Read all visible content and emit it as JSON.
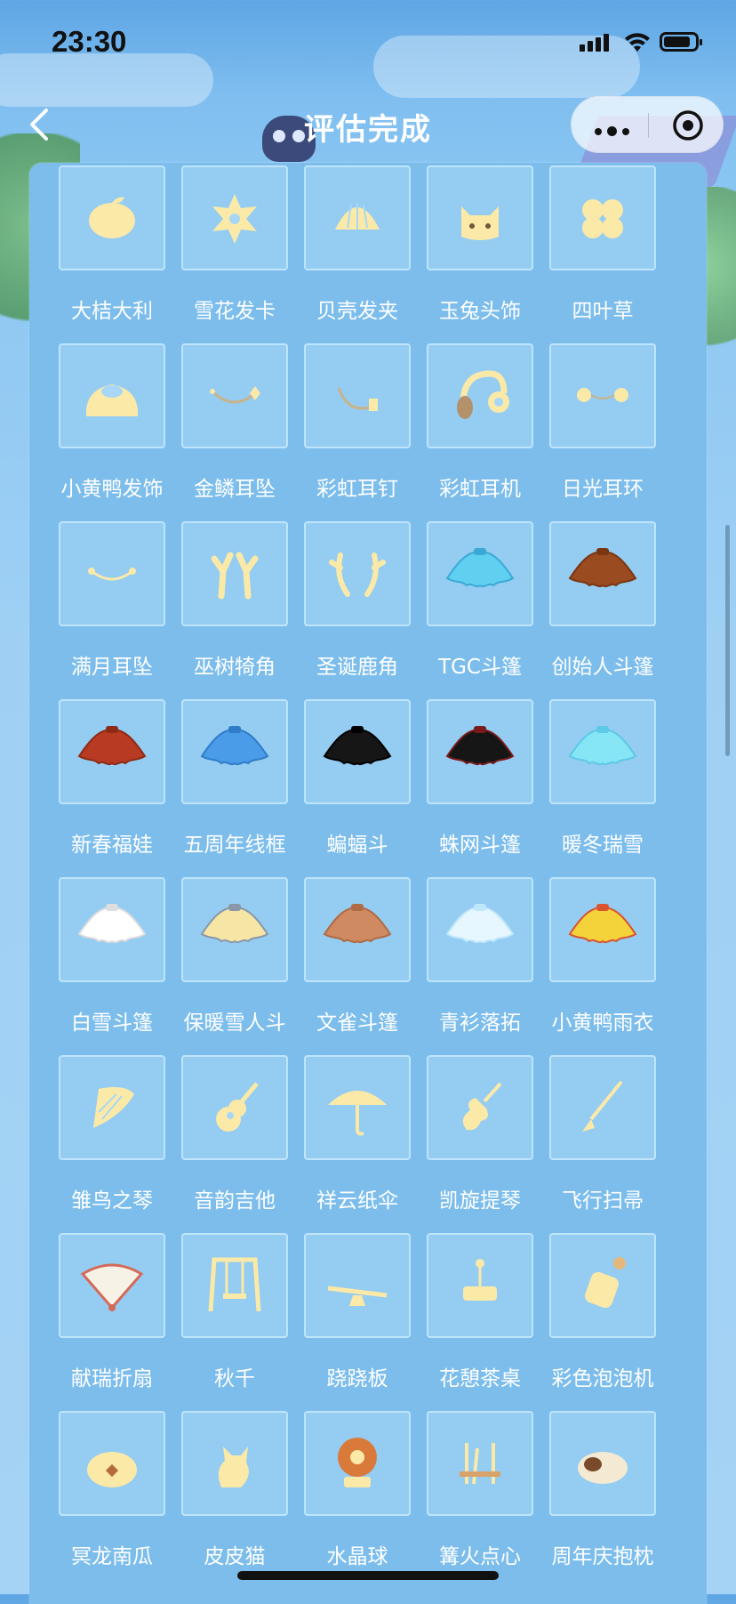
{
  "status_bar": {
    "time": "23:30",
    "battery_level": 0.85
  },
  "nav": {
    "title": "评估完成"
  },
  "colors": {
    "icon_yellow": "#fbe9a8",
    "label": "#ffffff",
    "tile_bg": "#a8d7f5"
  },
  "items": [
    {
      "label": "大桔大利",
      "icon": "tangerine-icon"
    },
    {
      "label": "雪花发卡",
      "icon": "snowflake-hairpin-icon"
    },
    {
      "label": "贝壳发夹",
      "icon": "shell-hairclip-icon"
    },
    {
      "label": "玉兔头饰",
      "icon": "rabbit-headwear-icon"
    },
    {
      "label": "四叶草",
      "icon": "clover-icon"
    },
    {
      "label": "小黄鸭发饰",
      "icon": "duck-hair-ornament-icon"
    },
    {
      "label": "金鳞耳坠",
      "icon": "golden-scale-earring-icon"
    },
    {
      "label": "彩虹耳钉",
      "icon": "rainbow-earstud-icon"
    },
    {
      "label": "彩虹耳机",
      "icon": "rainbow-headphones-icon"
    },
    {
      "label": "日光耳环",
      "icon": "sunlight-earring-icon"
    },
    {
      "label": "满月耳坠",
      "icon": "fullmoon-earring-icon"
    },
    {
      "label": "巫树犄角",
      "icon": "witch-tree-horns-icon"
    },
    {
      "label": "圣诞鹿角",
      "icon": "christmas-antlers-icon"
    },
    {
      "label": "TGC斗篷",
      "icon": "tgc-cape-icon"
    },
    {
      "label": "创始人斗篷",
      "icon": "founder-cape-icon"
    },
    {
      "label": "新春福娃",
      "icon": "new-year-cape-icon"
    },
    {
      "label": "五周年线框",
      "icon": "fifth-anniversary-cape-icon"
    },
    {
      "label": "蝙蝠斗",
      "icon": "bat-cape-icon"
    },
    {
      "label": "蛛网斗篷",
      "icon": "spiderweb-cape-icon"
    },
    {
      "label": "暖冬瑞雪",
      "icon": "winter-snow-cape-icon"
    },
    {
      "label": "白雪斗篷",
      "icon": "white-snow-cape-icon"
    },
    {
      "label": "保暖雪人斗",
      "icon": "snowman-cape-icon"
    },
    {
      "label": "文雀斗篷",
      "icon": "sparrow-cape-icon"
    },
    {
      "label": "青衫落拓",
      "icon": "blue-robe-cape-icon"
    },
    {
      "label": "小黄鸭雨衣",
      "icon": "duck-raincoat-icon"
    },
    {
      "label": "雏鸟之琴",
      "icon": "lyre-icon"
    },
    {
      "label": "音韵吉他",
      "icon": "guitar-icon"
    },
    {
      "label": "祥云纸伞",
      "icon": "paper-umbrella-icon"
    },
    {
      "label": "凯旋提琴",
      "icon": "violin-icon"
    },
    {
      "label": "飞行扫帚",
      "icon": "broom-icon"
    },
    {
      "label": "献瑞折扇",
      "icon": "folding-fan-icon"
    },
    {
      "label": "秋千",
      "icon": "swing-icon"
    },
    {
      "label": "跷跷板",
      "icon": "seesaw-icon"
    },
    {
      "label": "花憩茶桌",
      "icon": "tea-table-icon"
    },
    {
      "label": "彩色泡泡机",
      "icon": "bubble-machine-icon"
    },
    {
      "label": "冥龙南瓜",
      "icon": "pumpkin-icon"
    },
    {
      "label": "皮皮猫",
      "icon": "cat-icon"
    },
    {
      "label": "水晶球",
      "icon": "crystal-ball-icon"
    },
    {
      "label": "篝火点心",
      "icon": "campfire-snack-icon"
    },
    {
      "label": "周年庆抱枕",
      "icon": "anniversary-pillow-icon"
    }
  ]
}
